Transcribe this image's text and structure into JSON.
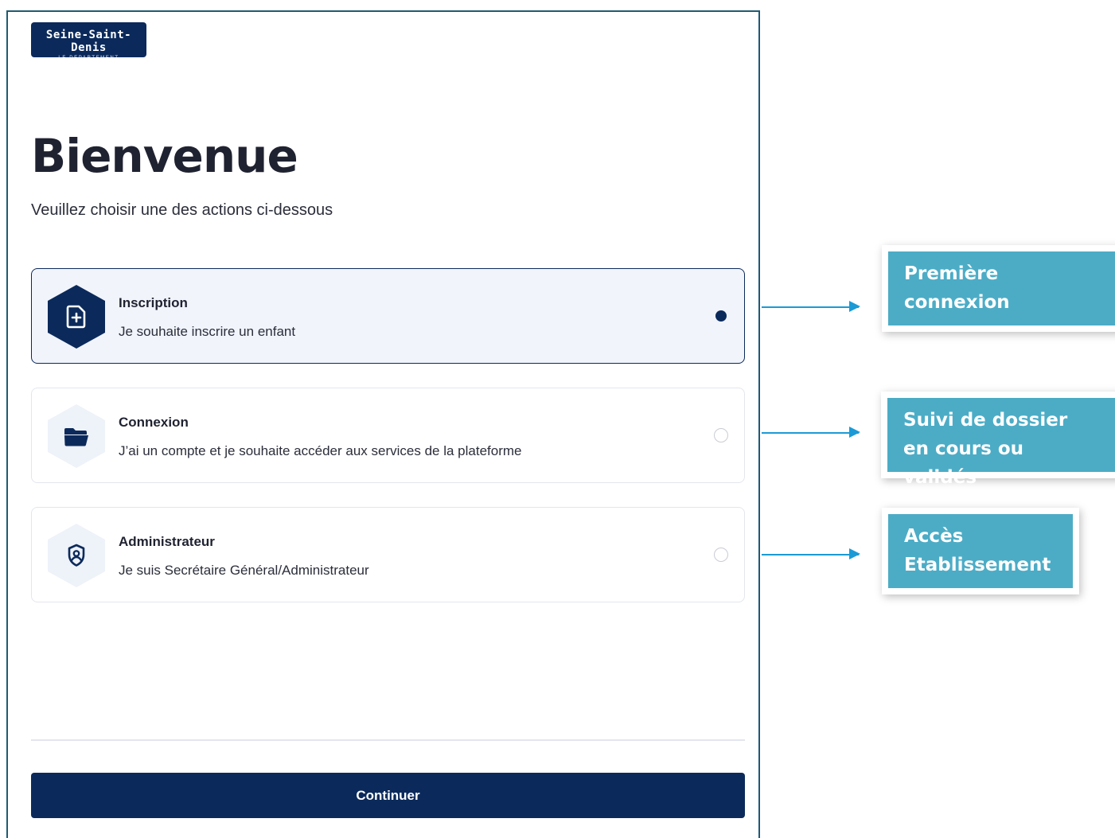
{
  "logo": {
    "text": "Seine-Saint-Denis",
    "subtext": "LE DÉPARTEMENT"
  },
  "header": {
    "title": "Bienvenue",
    "subtitle": "Veuillez choisir une des actions ci-dessous"
  },
  "options": [
    {
      "title": "Inscription",
      "description": "Je souhaite inscrire un enfant",
      "selected": true,
      "icon": "file-plus-icon"
    },
    {
      "title": "Connexion",
      "description": "J’ai un compte et je souhaite accéder aux services de la plateforme",
      "selected": false,
      "icon": "folder-icon"
    },
    {
      "title": "Administrateur",
      "description": "Je suis Secrétaire Général/Administrateur",
      "selected": false,
      "icon": "shield-user-icon"
    }
  ],
  "footer": {
    "continue_label": "Continuer"
  },
  "annotations": [
    {
      "text": "Première connexion"
    },
    {
      "text": "Suivi de dossier en cours ou validés"
    },
    {
      "text": "Accès Etablissement"
    }
  ],
  "colors": {
    "brand": "#0b2a5b",
    "panel_border": "#1f5a73",
    "callout": "#4cacc6",
    "arrow": "#1b9ad6"
  }
}
